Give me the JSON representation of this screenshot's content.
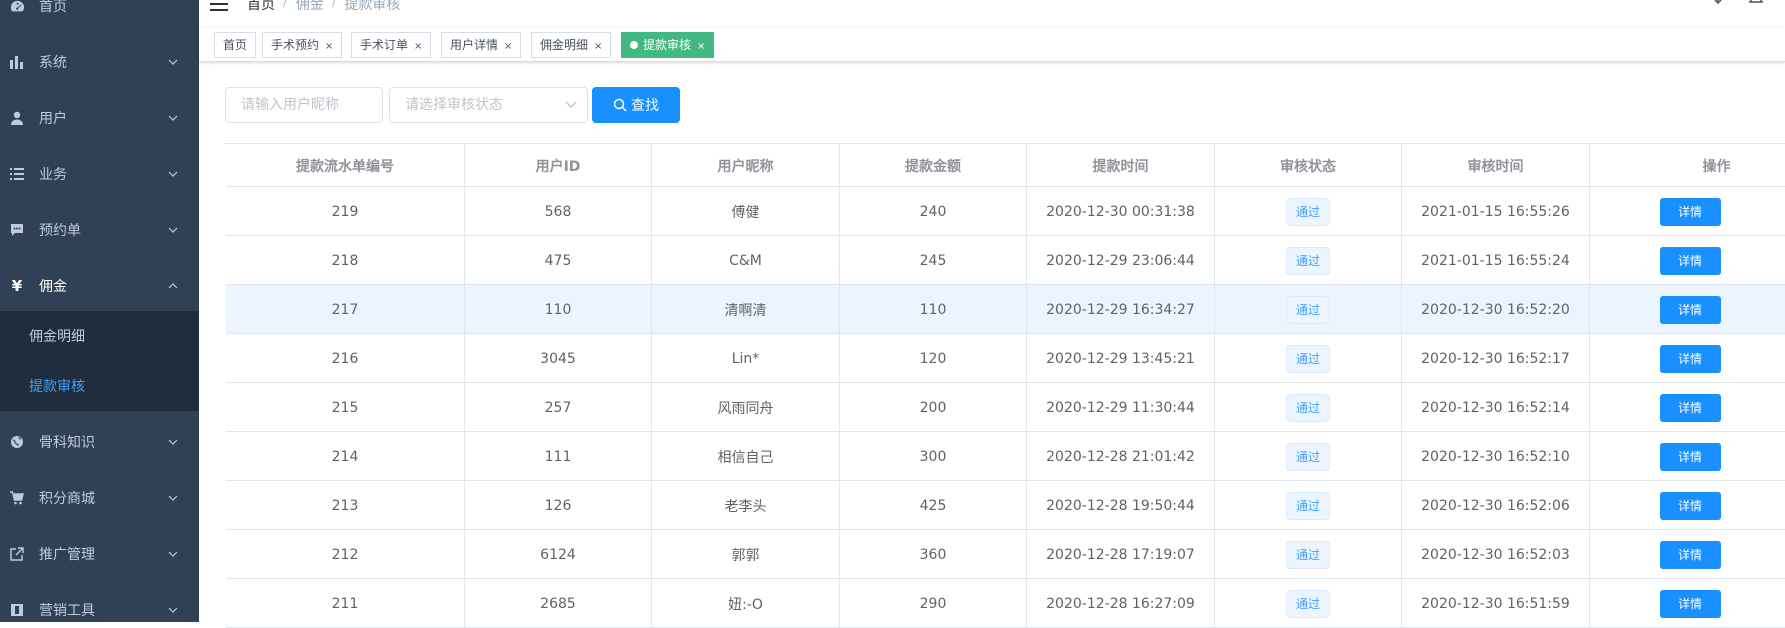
{
  "sidebar": {
    "items": [
      {
        "label": "首页",
        "icon": "dashboard-icon"
      },
      {
        "label": "系统",
        "icon": "bar-chart-icon"
      },
      {
        "label": "用户",
        "icon": "user-icon"
      },
      {
        "label": "业务",
        "icon": "list-icon"
      },
      {
        "label": "预约单",
        "icon": "message-icon"
      },
      {
        "label": "佣金",
        "icon": "yen-icon"
      },
      {
        "label": "骨科知识",
        "icon": "globe-icon"
      },
      {
        "label": "积分商城",
        "icon": "cart-icon"
      },
      {
        "label": "推广管理",
        "icon": "external-link-icon"
      },
      {
        "label": "营销工具",
        "icon": "tool-icon"
      }
    ],
    "submenu": [
      {
        "label": "佣金明细"
      },
      {
        "label": "提款审核"
      }
    ]
  },
  "breadcrumb": [
    "首页",
    "佣金",
    "提款审核"
  ],
  "tags": [
    {
      "label": "首页"
    },
    {
      "label": "手术预约"
    },
    {
      "label": "手术订单"
    },
    {
      "label": "用户详情"
    },
    {
      "label": "佣金明细"
    },
    {
      "label": "提款审核"
    }
  ],
  "tag_close": "×",
  "filters": {
    "nickname_placeholder": "请输入用户昵称",
    "status_placeholder": "请选择审核状态",
    "search_label": "查找"
  },
  "table": {
    "headers": [
      "提款流水单编号",
      "用户ID",
      "用户昵称",
      "提款金额",
      "提款时间",
      "审核状态",
      "审核时间",
      "操作"
    ],
    "rows": [
      {
        "id": "219",
        "uid": "568",
        "nick": "傅健",
        "amount": "240",
        "time": "2020-12-30 00:31:38",
        "status": "通过",
        "audit_time": "2021-01-15 16:55:26",
        "action": "详情"
      },
      {
        "id": "218",
        "uid": "475",
        "nick": "C&M",
        "amount": "245",
        "time": "2020-12-29 23:06:44",
        "status": "通过",
        "audit_time": "2021-01-15 16:55:24",
        "action": "详情"
      },
      {
        "id": "217",
        "uid": "110",
        "nick": "清啊清",
        "amount": "110",
        "time": "2020-12-29 16:34:27",
        "status": "通过",
        "audit_time": "2020-12-30 16:52:20",
        "action": "详情"
      },
      {
        "id": "216",
        "uid": "3045",
        "nick": "Lin*",
        "amount": "120",
        "time": "2020-12-29 13:45:21",
        "status": "通过",
        "audit_time": "2020-12-30 16:52:17",
        "action": "详情"
      },
      {
        "id": "215",
        "uid": "257",
        "nick": "风雨同舟",
        "amount": "200",
        "time": "2020-12-29 11:30:44",
        "status": "通过",
        "audit_time": "2020-12-30 16:52:14",
        "action": "详情"
      },
      {
        "id": "214",
        "uid": "111",
        "nick": "相信自己",
        "amount": "300",
        "time": "2020-12-28 21:01:42",
        "status": "通过",
        "audit_time": "2020-12-30 16:52:10",
        "action": "详情"
      },
      {
        "id": "213",
        "uid": "126",
        "nick": "老李头",
        "amount": "425",
        "time": "2020-12-28 19:50:44",
        "status": "通过",
        "audit_time": "2020-12-30 16:52:06",
        "action": "详情"
      },
      {
        "id": "212",
        "uid": "6124",
        "nick": "郭郭",
        "amount": "360",
        "time": "2020-12-28 17:19:07",
        "status": "通过",
        "audit_time": "2020-12-30 16:52:03",
        "action": "详情"
      },
      {
        "id": "211",
        "uid": "2685",
        "nick": "妞:-O",
        "amount": "290",
        "time": "2020-12-28 16:27:09",
        "status": "通过",
        "audit_time": "2020-12-30 16:51:59",
        "action": "详情"
      }
    ]
  },
  "colors": {
    "sidebar_bg": "#304156",
    "submenu_bg": "#1f2d3d",
    "active_tag": "#42b983",
    "primary": "#1890ff",
    "active_link": "#409eff"
  }
}
